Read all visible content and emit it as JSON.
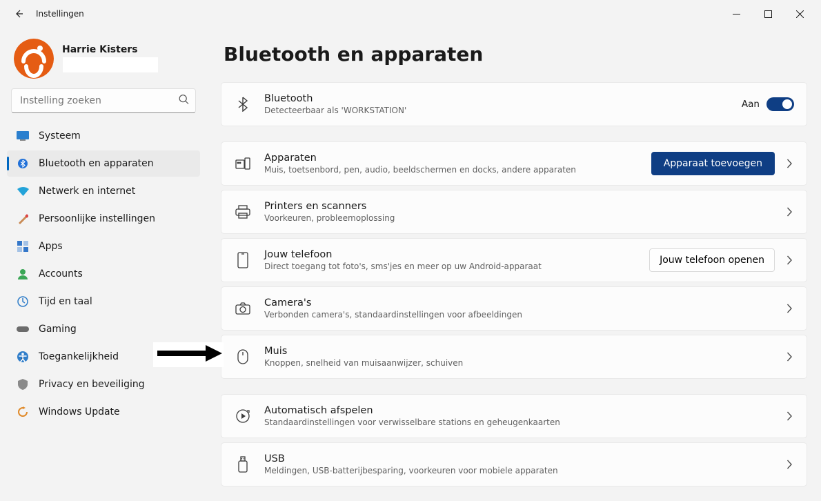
{
  "window": {
    "title": "Instellingen"
  },
  "user": {
    "name": "Harrie Kisters"
  },
  "search": {
    "placeholder": "Instelling zoeken"
  },
  "sidebar": {
    "items": [
      {
        "label": "Systeem"
      },
      {
        "label": "Bluetooth en apparaten"
      },
      {
        "label": "Netwerk en internet"
      },
      {
        "label": "Persoonlijke instellingen"
      },
      {
        "label": "Apps"
      },
      {
        "label": "Accounts"
      },
      {
        "label": "Tijd en taal"
      },
      {
        "label": "Gaming"
      },
      {
        "label": "Toegankelijkheid"
      },
      {
        "label": "Privacy en beveiliging"
      },
      {
        "label": "Windows Update"
      }
    ],
    "selected_index": 1
  },
  "main": {
    "heading": "Bluetooth en apparaten",
    "bluetooth_card": {
      "title": "Bluetooth",
      "subtitle": "Detecteerbaar als 'WORKSTATION'",
      "toggle_label": "Aan",
      "toggle_on": true
    },
    "devices_card": {
      "title": "Apparaten",
      "subtitle": "Muis, toetsenbord, pen, audio, beeldschermen en docks, andere apparaten",
      "button_label": "Apparaat toevoegen"
    },
    "printers_card": {
      "title": "Printers en scanners",
      "subtitle": "Voorkeuren, probleemoplossing"
    },
    "phone_card": {
      "title": "Jouw telefoon",
      "subtitle": "Direct toegang tot foto's, sms'jes en meer op uw Android-apparaat",
      "button_label": "Jouw telefoon openen"
    },
    "cameras_card": {
      "title": "Camera's",
      "subtitle": "Verbonden camera's, standaardinstellingen voor afbeeldingen"
    },
    "mouse_card": {
      "title": "Muis",
      "subtitle": "Knoppen, snelheid van muisaanwijzer, schuiven"
    },
    "autoplay_card": {
      "title": "Automatisch afspelen",
      "subtitle": "Standaardinstellingen voor verwisselbare stations en geheugenkaarten"
    },
    "usb_card": {
      "title": "USB",
      "subtitle": "Meldingen, USB-batterijbesparing, voorkeuren voor mobiele apparaten"
    }
  }
}
